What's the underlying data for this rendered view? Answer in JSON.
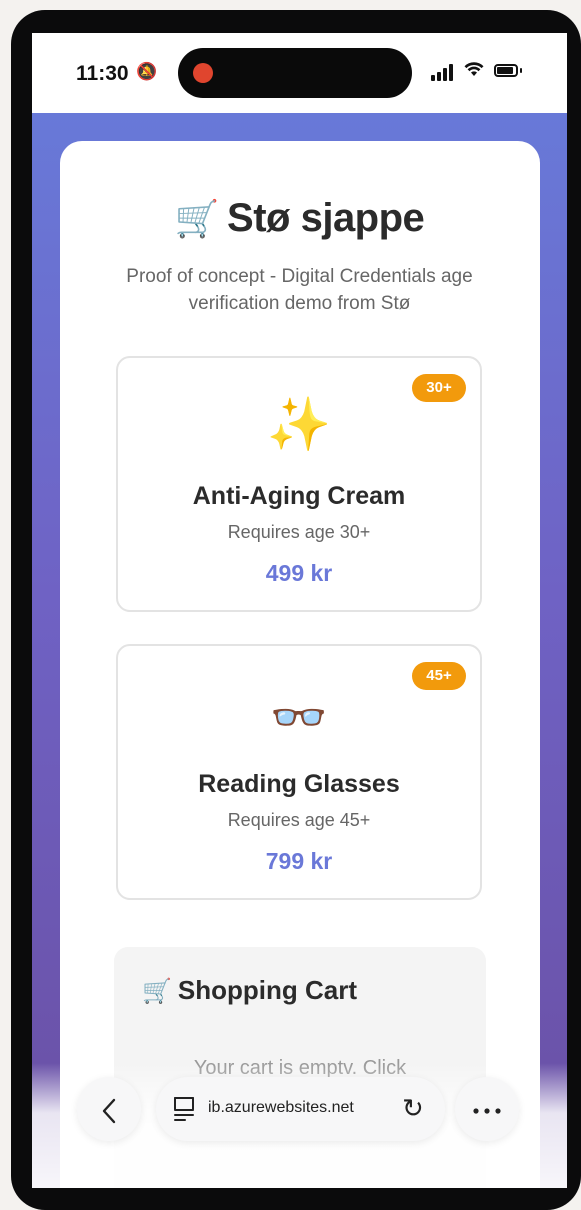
{
  "status_bar": {
    "time": "11:30",
    "icons": [
      "bell-slash-icon",
      "signal-icon",
      "wifi-icon",
      "battery-icon"
    ]
  },
  "header": {
    "title_emoji": "🛒",
    "title": "Stø sjappe",
    "subtitle": "Proof of concept - Digital Credentials age verification demo from Stø"
  },
  "products": [
    {
      "badge": "30+",
      "emoji": "✨",
      "name": "Anti-Aging Cream",
      "requirement": "Requires age 30+",
      "price": "499 kr"
    },
    {
      "badge": "45+",
      "emoji": "👓",
      "name": "Reading Glasses",
      "requirement": "Requires age 45+",
      "price": "799 kr"
    }
  ],
  "cart": {
    "emoji": "🛒",
    "title": "Shopping Cart",
    "empty_text": "Your cart is emptv. Click"
  },
  "browser": {
    "url": "ib.azurewebsites.net",
    "back_icon": "chevron-left-icon",
    "tabs_icon": "tabs-icon",
    "reload_icon": "reload-icon",
    "more_icon": "more-icon"
  },
  "colors": {
    "accent": "#6a78d8",
    "badge": "#f29a0c",
    "gradient_top": "#6879d8",
    "gradient_bottom": "#6a4fa3"
  }
}
